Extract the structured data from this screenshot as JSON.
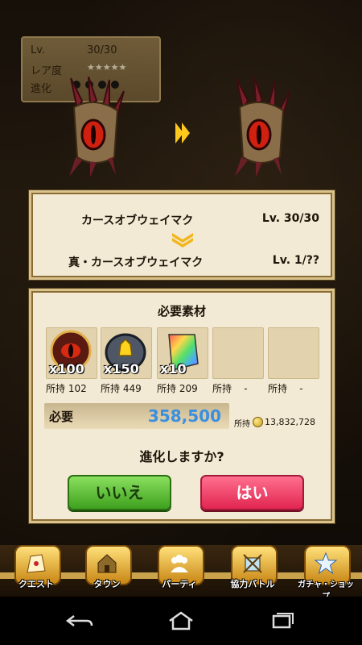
{
  "status_panel": {
    "lv_label": "Lv.",
    "lv_value": "30/30",
    "rarity_label": "レア度",
    "rarity_stars": "★★★★★",
    "evolution_label": "進化"
  },
  "evolution": {
    "from_name": "カースオブウェイマク",
    "from_level": "Lv.  30/30",
    "to_name": "真・カースオブウェイマク",
    "to_level": "Lv.  1/??"
  },
  "materials": {
    "title": "必要素材",
    "slots": [
      {
        "qty": "x100",
        "owned_label": "所持",
        "owned": "102",
        "icon": "eye-orb-icon"
      },
      {
        "qty": "x150",
        "owned_label": "所持",
        "owned": "449",
        "icon": "golden-glove-stone-icon"
      },
      {
        "qty": "x10",
        "owned_label": "所持",
        "owned": "209",
        "icon": "rainbow-crystal-icon"
      },
      {
        "qty": "",
        "owned_label": "所持",
        "owned": "-",
        "icon": "empty-slot"
      },
      {
        "qty": "",
        "owned_label": "所持",
        "owned": "-",
        "icon": "empty-slot"
      }
    ]
  },
  "cost": {
    "label": "必要",
    "value": "358,500",
    "have_label": "所持",
    "have_value": "13,832,728"
  },
  "confirm": {
    "question": "進化しますか?",
    "no_label": "いいえ",
    "yes_label": "はい"
  },
  "nav": {
    "items": [
      {
        "label": "クエスト",
        "icon": "quest-icon"
      },
      {
        "label": "タウン",
        "icon": "town-icon"
      },
      {
        "label": "パーティ",
        "icon": "party-icon"
      },
      {
        "label": "協力バトル",
        "icon": "coop-battle-icon"
      },
      {
        "label": "ガチャ・ショップ",
        "icon": "gacha-shop-icon"
      }
    ]
  },
  "colors": {
    "accent_cost": "#3a8fe0",
    "button_no": "#3ea11f",
    "button_yes": "#e12651",
    "panel_bg": "#f3ead5"
  }
}
